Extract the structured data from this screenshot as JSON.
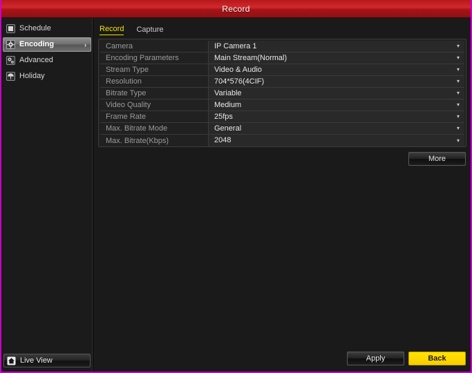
{
  "window": {
    "title": "Record",
    "accent_red": "#c8272b",
    "accent_yellow": "#f6e200",
    "border_color": "#cc00cc"
  },
  "sidebar": {
    "items": [
      {
        "label": "Schedule",
        "icon": "calendar-icon",
        "selected": false,
        "chevron": ""
      },
      {
        "label": "Encoding",
        "icon": "gear-icon",
        "selected": true,
        "chevron": "›"
      },
      {
        "label": "Advanced",
        "icon": "gears-icon",
        "selected": false,
        "chevron": ""
      },
      {
        "label": "Holiday",
        "icon": "umbrella-icon",
        "selected": false,
        "chevron": ""
      }
    ],
    "live_view": {
      "label": "Live View",
      "icon": "home-icon"
    }
  },
  "main": {
    "tabs": [
      {
        "label": "Record",
        "active": true
      },
      {
        "label": "Capture",
        "active": false
      }
    ],
    "settings_rows": [
      {
        "label": "Camera",
        "value": "IP Camera 1",
        "chevron": "▾"
      },
      {
        "label": "Encoding Parameters",
        "value": "Main Stream(Normal)",
        "chevron": "▾"
      },
      {
        "label": "Stream Type",
        "value": "Video & Audio",
        "chevron": "▾"
      },
      {
        "label": "Resolution",
        "value": "704*576(4CIF)",
        "chevron": "▾"
      },
      {
        "label": "Bitrate Type",
        "value": "Variable",
        "chevron": "▾"
      },
      {
        "label": "Video Quality",
        "value": "Medium",
        "chevron": "▾"
      },
      {
        "label": "Frame Rate",
        "value": "25fps",
        "chevron": "▾"
      },
      {
        "label": "Max. Bitrate Mode",
        "value": "General",
        "chevron": "▾"
      },
      {
        "label": "Max. Bitrate(Kbps)",
        "value": "2048",
        "chevron": "▾"
      }
    ],
    "more_button": "More",
    "footer": {
      "apply_label": "Apply",
      "back_label": "Back"
    }
  }
}
